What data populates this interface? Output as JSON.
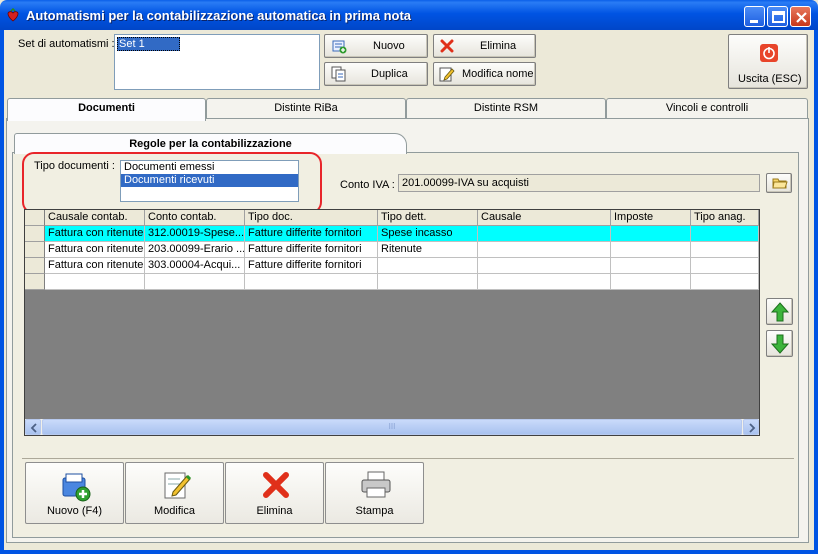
{
  "window": {
    "title": "Automatismi per la contabilizzazione automatica in prima nota"
  },
  "set": {
    "label": "Set di automatismi :",
    "items": [
      "Set 1"
    ]
  },
  "toolbar": {
    "nuovo": "Nuovo",
    "elimina": "Elimina",
    "duplica": "Duplica",
    "modifica_nome": "Modifica nome",
    "uscita": "Uscita (ESC)"
  },
  "tabs": [
    "Documenti",
    "Distinte RiBa",
    "Distinte RSM",
    "Vincoli e controlli"
  ],
  "subtab": "Regole per la contabilizzazione",
  "tipo_documenti": {
    "label": "Tipo documenti :",
    "items": [
      "Documenti emessi",
      "Documenti ricevuti"
    ],
    "selected": "Documenti ricevuti"
  },
  "conto_iva": {
    "label": "Conto IVA :",
    "value": "201.00099-IVA su acquisti"
  },
  "grid": {
    "columns": [
      "Causale contab.",
      "Conto contab.",
      "Tipo doc.",
      "Tipo dett.",
      "Causale",
      "Imposte",
      "Tipo anag."
    ],
    "rows": [
      [
        "Fattura con ritenute",
        "312.00019-Spese...",
        "Fatture differite fornitori",
        "Spese incasso",
        "",
        "",
        ""
      ],
      [
        "Fattura con ritenute",
        "203.00099-Erario ...",
        "Fatture differite fornitori",
        "Ritenute",
        "",
        "",
        ""
      ],
      [
        "Fattura con ritenute",
        "303.00004-Acqui...",
        "Fatture differite fornitori",
        "",
        "",
        "",
        ""
      ],
      [
        "",
        "",
        "",
        "",
        "",
        "",
        ""
      ]
    ],
    "selected_row": 0,
    "scroll_grip": "III"
  },
  "bottom_buttons": {
    "nuovo": "Nuovo (F4)",
    "modifica": "Modifica",
    "elimina": "Elimina",
    "stampa": "Stampa"
  },
  "icons": {
    "app": "strawberry-icon",
    "nuovo": "add-document-icon",
    "elimina": "red-x-icon",
    "duplica": "copy-icon",
    "modifica_nome": "edit-icon",
    "uscita": "power-icon",
    "folder": "folder-icon",
    "up": "green-up-arrow-icon",
    "down": "green-down-arrow-icon",
    "stampa": "printer-icon"
  },
  "colors": {
    "titlebar": "#0054e3",
    "selection": "#316ac5",
    "grid_selected_row": "#00ffff",
    "highlight_outline": "#e8252a"
  }
}
